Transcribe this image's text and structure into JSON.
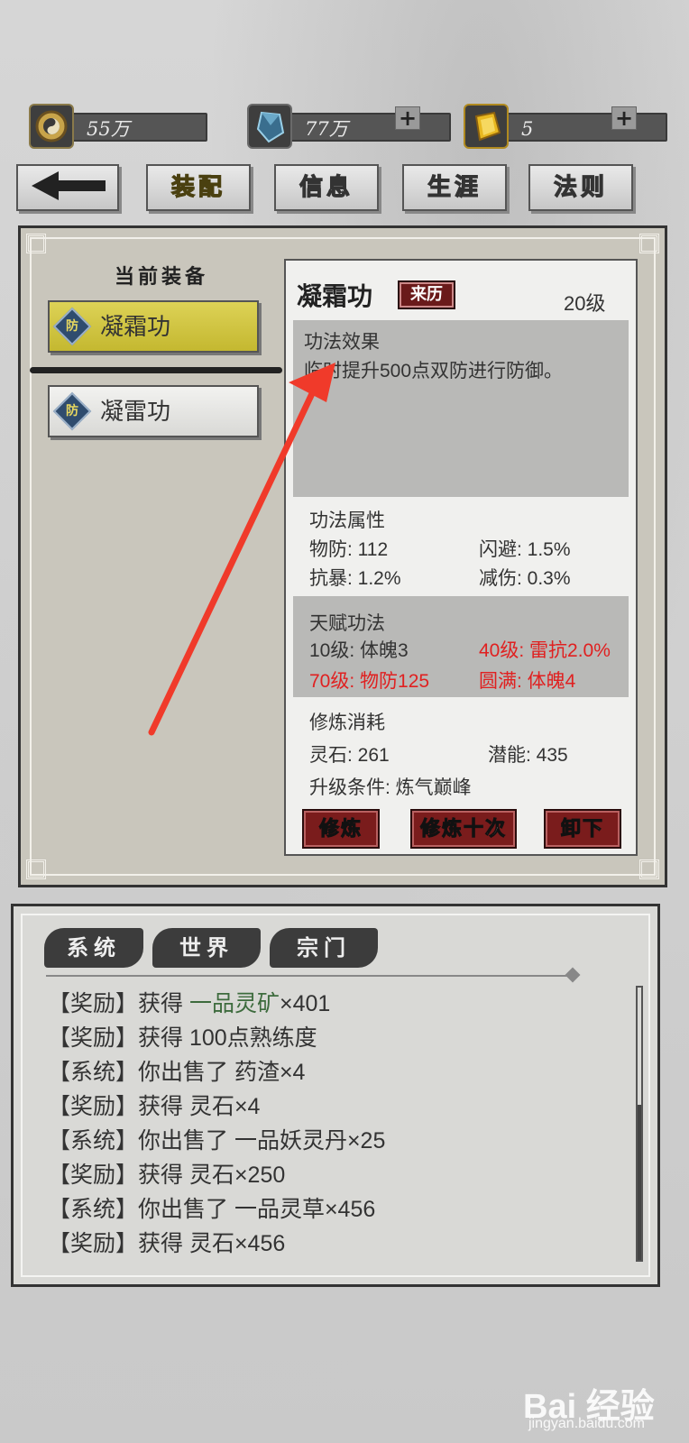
{
  "resources": [
    {
      "value": "55万",
      "plus": false
    },
    {
      "value": "77万",
      "plus": true
    },
    {
      "value": "5",
      "plus": true
    }
  ],
  "nav": {
    "back": "back",
    "tabs": [
      {
        "label": "装配",
        "active": true
      },
      {
        "label": "信息",
        "active": false
      },
      {
        "label": "生涯",
        "active": false
      },
      {
        "label": "法则",
        "active": false
      }
    ]
  },
  "current_equip": {
    "heading": "当前装备",
    "items": [
      {
        "icon": "防",
        "label": "凝霜功",
        "selected": true
      },
      {
        "icon": "防",
        "label": "凝雷功",
        "selected": false
      }
    ]
  },
  "detail": {
    "name": "凝霜功",
    "origin_button": "来历",
    "level": "20级",
    "effect_title": "功法效果",
    "effect_text": "临时提升500点双防进行防御。",
    "attr_title": "功法属性",
    "attrs": [
      "物防: 112",
      "闪避: 1.5%",
      "抗暴: 1.2%",
      "减伤: 0.3%"
    ],
    "talent_title": "天赋功法",
    "talents": [
      {
        "text": "10级: 体魄3",
        "locked": false
      },
      {
        "text": "40级: 雷抗2.0%",
        "locked": true
      },
      {
        "text": "70级: 物防125",
        "locked": true
      },
      {
        "text": "圆满: 体魄4",
        "locked": true
      }
    ],
    "cost_title": "修炼消耗",
    "costs": [
      "灵石: 261",
      "潜能: 435"
    ],
    "upgrade_cond": "升级条件: 炼气巅峰",
    "buttons": [
      "修炼",
      "修炼十次",
      "卸下"
    ]
  },
  "log": {
    "tabs": [
      "系统",
      "世界",
      "宗门"
    ],
    "lines": [
      {
        "tag": "【奖励】",
        "pre": "获得 ",
        "hl": "一品灵矿",
        "post": "×401"
      },
      {
        "tag": "【奖励】",
        "pre": "获得 100点熟练度",
        "hl": "",
        "post": ""
      },
      {
        "tag": "【系统】",
        "pre": "你出售了 药渣×4",
        "hl": "",
        "post": ""
      },
      {
        "tag": "【奖励】",
        "pre": "获得 灵石×4",
        "hl": "",
        "post": ""
      },
      {
        "tag": "【系统】",
        "pre": "你出售了 一品妖灵丹×25",
        "hl": "",
        "post": ""
      },
      {
        "tag": "【奖励】",
        "pre": "获得 灵石×250",
        "hl": "",
        "post": ""
      },
      {
        "tag": "【系统】",
        "pre": "你出售了 一品灵草×456",
        "hl": "",
        "post": ""
      },
      {
        "tag": "【奖励】",
        "pre": "获得 灵石×456",
        "hl": "",
        "post": ""
      }
    ]
  },
  "watermark": {
    "brand": "Bai 经验",
    "url": "jingyan.baidu.com"
  },
  "colors": {
    "accent_yellow": "#d8cc4a",
    "button_red": "#7a1c1c",
    "locked_red": "#e02020",
    "highlight_green": "#3d6b3d"
  }
}
